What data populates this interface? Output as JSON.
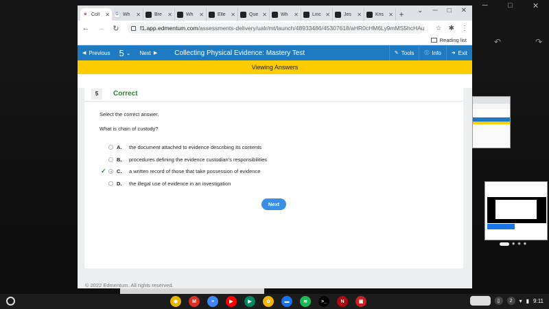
{
  "browser": {
    "tabs": [
      {
        "label": "Coll",
        "fav": "e",
        "icon": "edmentum-icon",
        "active": true
      },
      {
        "label": "Wh",
        "fav": "g",
        "icon": "google-icon"
      },
      {
        "label": "Bre",
        "fav": "b",
        "icon": "brainly-icon"
      },
      {
        "label": "Wh",
        "fav": "b",
        "icon": "brainly-icon"
      },
      {
        "label": "Elle",
        "fav": "b",
        "icon": "brainly-icon"
      },
      {
        "label": "Que",
        "fav": "b",
        "icon": "brainly-icon"
      },
      {
        "label": "Wh",
        "fav": "b",
        "icon": "brainly-icon"
      },
      {
        "label": "Linc",
        "fav": "b",
        "icon": "brainly-icon"
      },
      {
        "label": "Jes",
        "fav": "b",
        "icon": "brainly-icon"
      },
      {
        "label": "Kris",
        "fav": "b",
        "icon": "brainly-icon"
      }
    ],
    "url_host": "f1.app.edmentum.com",
    "url_path": "/assessments-delivery/ualr/mt/launch/48933486/45307618/aHR0cHM6Ly9mMS5hcHAuZWRtZW50dW0uY29t...",
    "reading_list": "Reading list"
  },
  "toolbar": {
    "previous": "Previous",
    "question_number": "5",
    "next": "Next",
    "title": "Collecting Physical Evidence: Mastery Test",
    "tools": "Tools",
    "info": "Info",
    "exit": "Exit"
  },
  "banner": "Viewing Answers",
  "question": {
    "number": "5",
    "status": "Correct",
    "instruction": "Select the correct answer.",
    "prompt": "What is chain of custody?",
    "options": [
      {
        "letter": "A.",
        "text": "the document attached to evidence describing its contents",
        "selected": false,
        "correct": false
      },
      {
        "letter": "B.",
        "text": "procedures defining the evidence custodian's responsibilities",
        "selected": false,
        "correct": false
      },
      {
        "letter": "C.",
        "text": "a written record of those that take possession of evidence",
        "selected": true,
        "correct": true
      },
      {
        "letter": "D.",
        "text": "the illegal use of evidence in an investigation",
        "selected": false,
        "correct": false
      }
    ],
    "next_button": "Next"
  },
  "footer": "© 2022 Edmentum. All rights reserved.",
  "shelf": {
    "apps": [
      {
        "name": "chrome-icon",
        "color": "#e8b400",
        "glyph": "◉"
      },
      {
        "name": "gmail-icon",
        "color": "#d93025",
        "glyph": "M"
      },
      {
        "name": "docs-icon",
        "color": "#4285f4",
        "glyph": "≡"
      },
      {
        "name": "youtube-icon",
        "color": "#ff0000",
        "glyph": "▶"
      },
      {
        "name": "play-store-icon",
        "color": "#01875f",
        "glyph": "▶"
      },
      {
        "name": "photos-icon",
        "color": "#f4b400",
        "glyph": "✿"
      },
      {
        "name": "files-icon",
        "color": "#1a73e8",
        "glyph": "▬"
      },
      {
        "name": "spotify-icon",
        "color": "#1db954",
        "glyph": "≋"
      },
      {
        "name": "terminal-icon",
        "color": "#000000",
        "glyph": ">_"
      },
      {
        "name": "netflix-icon",
        "color": "#b00710",
        "glyph": "N"
      },
      {
        "name": "screenshot-icon",
        "color": "#c5221f",
        "glyph": "▣"
      }
    ],
    "status_count": "2",
    "time": "9:11"
  },
  "colors": {
    "toolbar_blue": "#1f7bc1",
    "banner_yellow": "#ffcc00",
    "correct_green": "#2e7d32",
    "next_button_blue": "#3a8ee3"
  }
}
